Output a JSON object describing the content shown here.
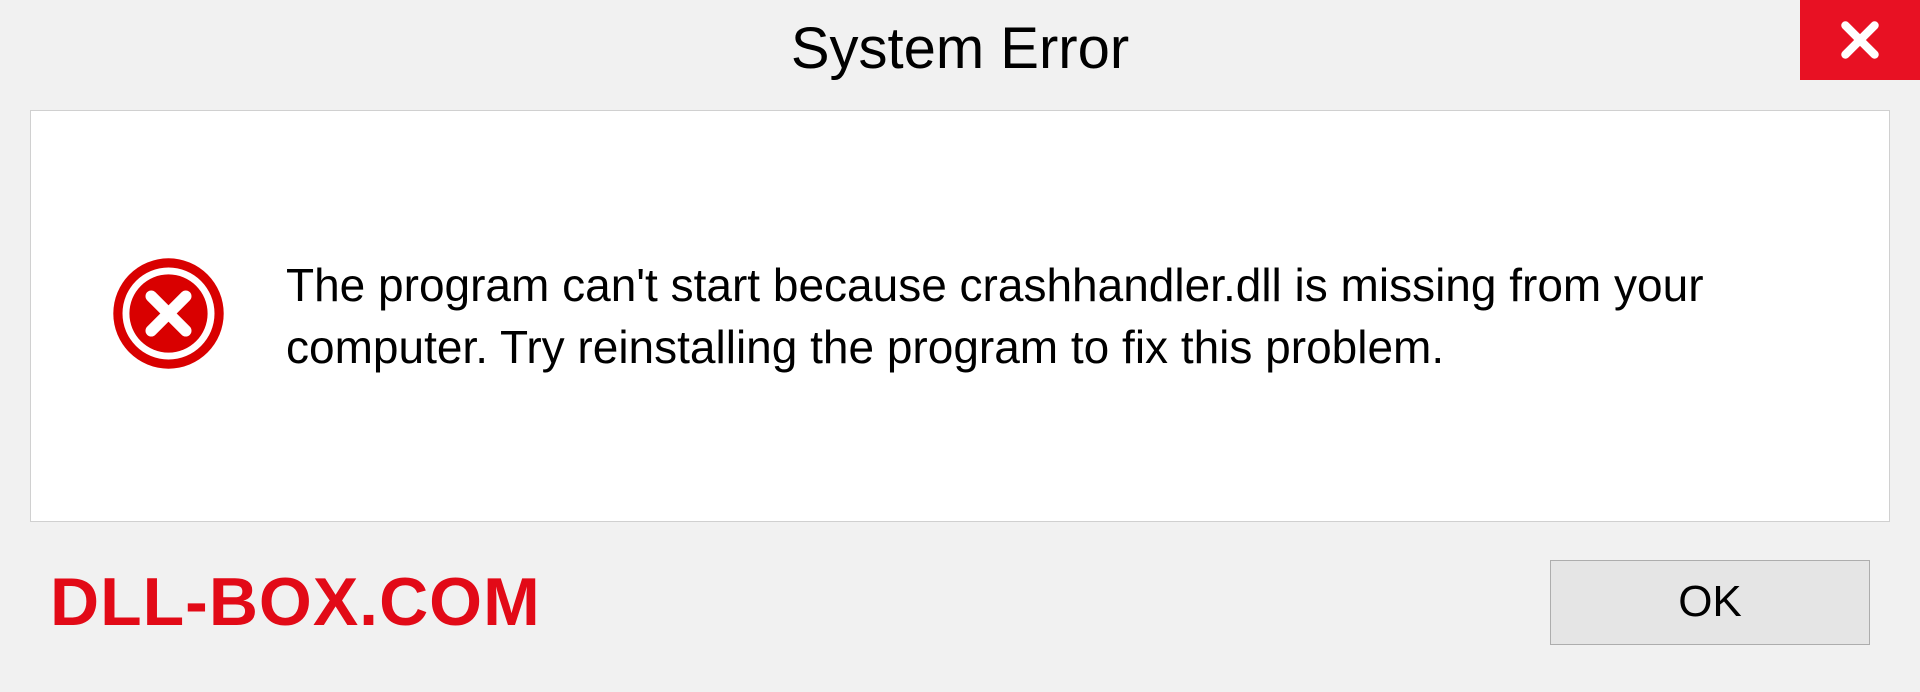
{
  "dialog": {
    "title": "System Error",
    "message": "The program can't start because crashhandler.dll is missing from your computer. Try reinstalling the program to fix this problem.",
    "ok_label": "OK"
  },
  "watermark": "DLL-BOX.COM",
  "colors": {
    "accent_red": "#e81123",
    "watermark_red": "#e20a17"
  }
}
